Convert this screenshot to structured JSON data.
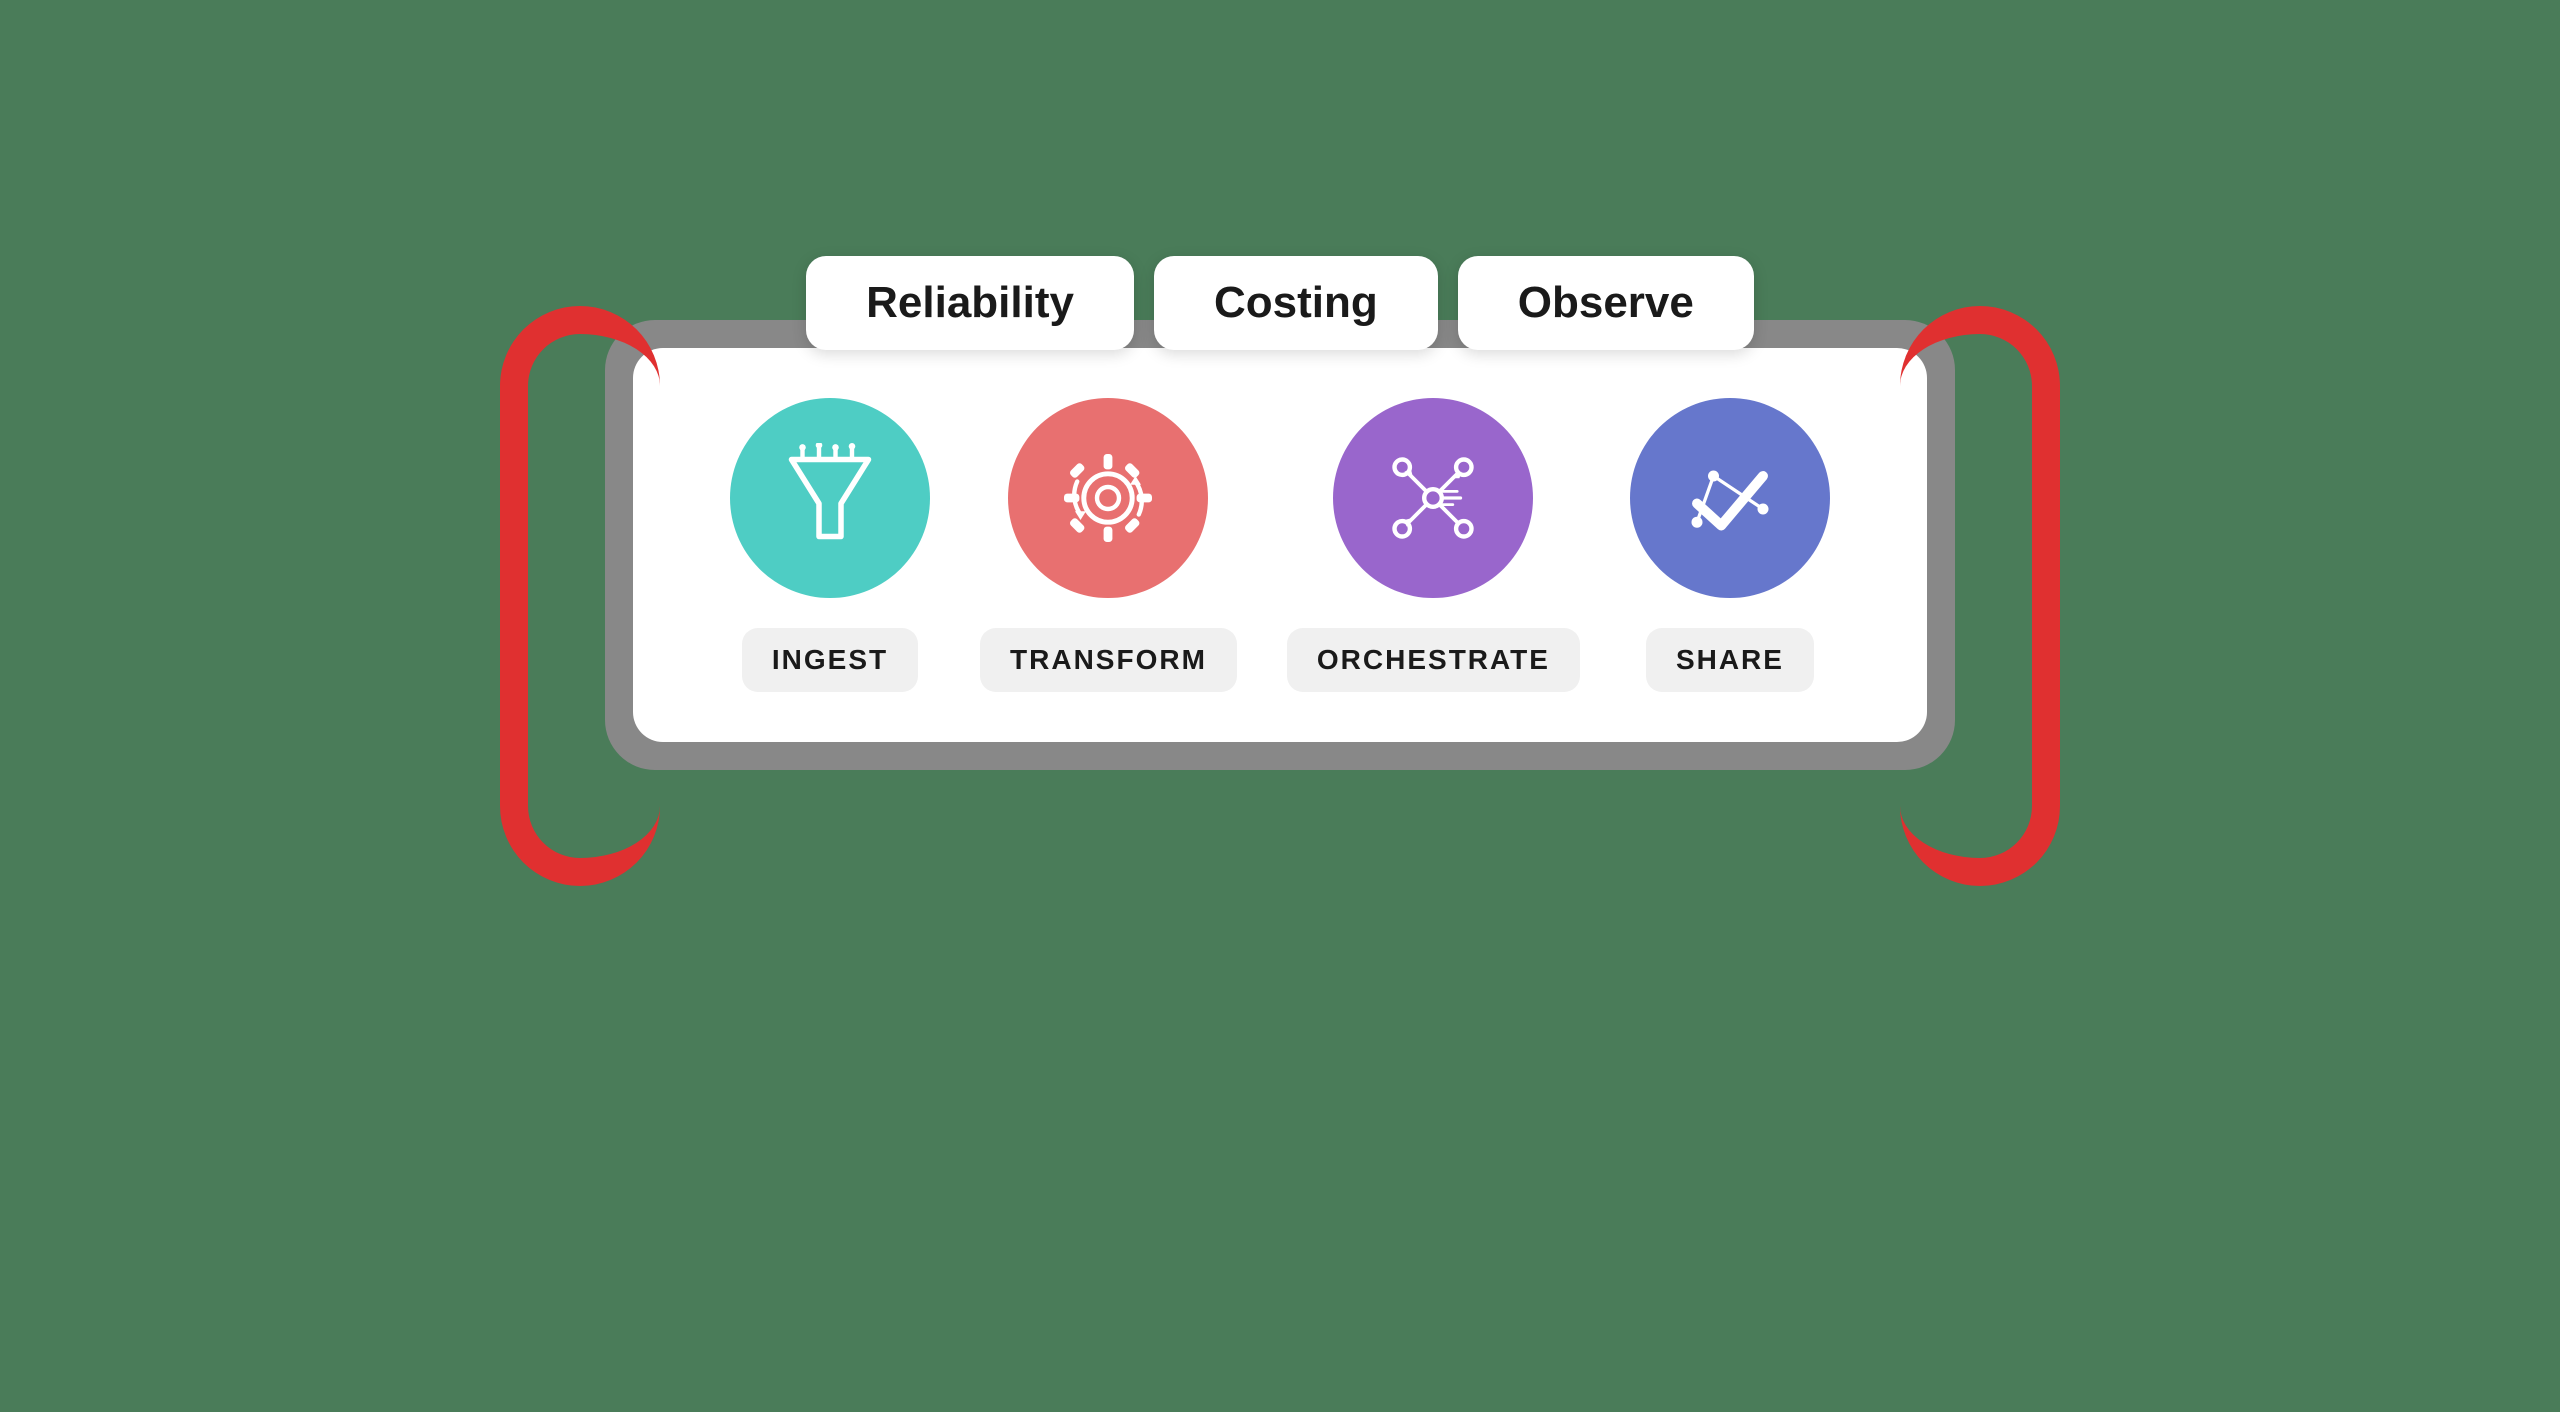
{
  "tabs": [
    {
      "id": "reliability",
      "label": "Reliability"
    },
    {
      "id": "costing",
      "label": "Costing"
    },
    {
      "id": "observe",
      "label": "Observe"
    }
  ],
  "pipeline": [
    {
      "id": "ingest",
      "label": "INGEST",
      "color": "#4ecdc4",
      "icon": "funnel"
    },
    {
      "id": "transform",
      "label": "TRANSFORM",
      "color": "#e87070",
      "icon": "gear"
    },
    {
      "id": "orchestrate",
      "label": "ORCHESTRATE",
      "color": "#9966cc",
      "icon": "network"
    },
    {
      "id": "share",
      "label": "SHARE",
      "color": "#6677cc",
      "icon": "checkmark"
    }
  ],
  "colors": {
    "background": "#4a7c59",
    "red_arc": "#e03030",
    "gray_outer": "#888888",
    "white_inner": "#ffffff"
  }
}
